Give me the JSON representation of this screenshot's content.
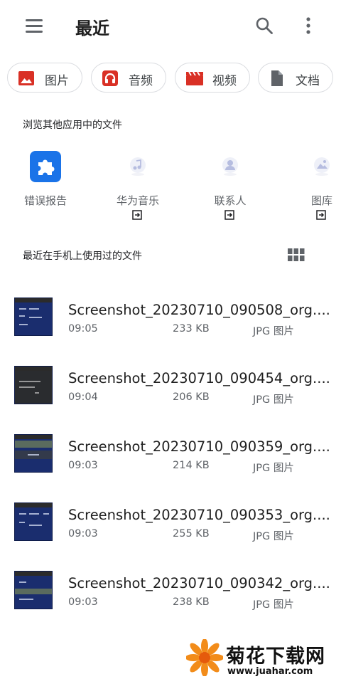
{
  "header": {
    "title": "最近",
    "menu_icon": "hamburger-menu-icon",
    "search_icon": "search-icon",
    "more_icon": "more-vert-icon"
  },
  "chips": [
    {
      "label": "图片",
      "icon": "image-icon",
      "color": "#d93025"
    },
    {
      "label": "音频",
      "icon": "headphones-icon",
      "color": "#d93025"
    },
    {
      "label": "视频",
      "icon": "clapperboard-icon",
      "color": "#d93025"
    },
    {
      "label": "文档",
      "icon": "document-icon",
      "color": "#5f6368"
    }
  ],
  "browse_section": {
    "title": "浏览其他应用中的文件",
    "apps": [
      {
        "label": "错误报告",
        "icon": "puzzle-icon",
        "color": "#1a73e8",
        "has_open_icon": false
      },
      {
        "label": "华为音乐",
        "icon": "music-app-icon",
        "has_open_icon": true
      },
      {
        "label": "联系人",
        "icon": "contacts-app-icon",
        "has_open_icon": true
      },
      {
        "label": "图库",
        "icon": "gallery-app-icon",
        "has_open_icon": true
      }
    ]
  },
  "recent_section": {
    "title": "最近在手机上使用过的文件",
    "grid_icon": "grid-view-icon",
    "files": [
      {
        "name": "Screenshot_20230710_090508_org....",
        "time": "09:05",
        "size": "233 KB",
        "type": "JPG 图片"
      },
      {
        "name": "Screenshot_20230710_090454_org....",
        "time": "09:04",
        "size": "206 KB",
        "type": "JPG 图片"
      },
      {
        "name": "Screenshot_20230710_090359_org....",
        "time": "09:03",
        "size": "214 KB",
        "type": "JPG 图片"
      },
      {
        "name": "Screenshot_20230710_090353_org....",
        "time": "09:03",
        "size": "255 KB",
        "type": "JPG 图片"
      },
      {
        "name": "Screenshot_20230710_090342_org....",
        "time": "09:03",
        "size": "238 KB",
        "type": "JPG 图片"
      }
    ]
  },
  "watermark": {
    "text": "菊花下载网",
    "url": "www.juahar.com"
  }
}
